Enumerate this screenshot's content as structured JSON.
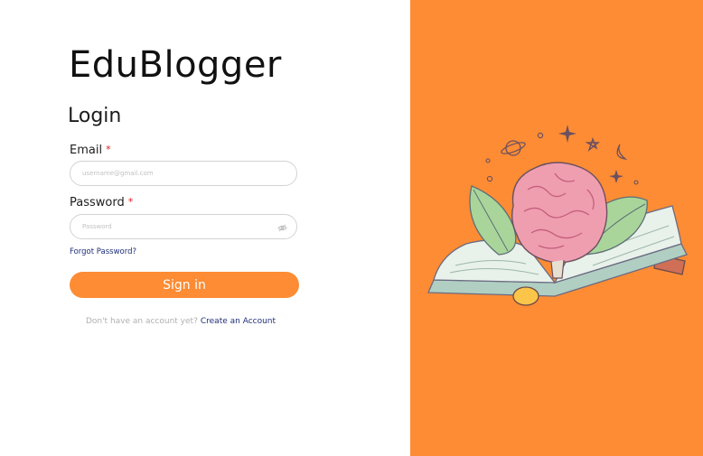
{
  "brand": {
    "name": "EduBlogger"
  },
  "form": {
    "heading": "Login",
    "email": {
      "label": "Email",
      "required_mark": "*",
      "placeholder": "username@gmail.com",
      "value": ""
    },
    "password": {
      "label": "Password",
      "required_mark": "*",
      "placeholder": "Password",
      "value": ""
    },
    "forgot_link": "Forgot Password?",
    "submit_label": "Sign in",
    "signup_prompt": "Don't have an account yet?",
    "signup_link": "Create an Account"
  },
  "colors": {
    "accent": "#fd8c34",
    "link": "#1f2f78",
    "required": "#e11d1d"
  },
  "icons": {
    "password_toggle": "eye-slash-icon",
    "illustration": "brain-on-book-illustration"
  }
}
